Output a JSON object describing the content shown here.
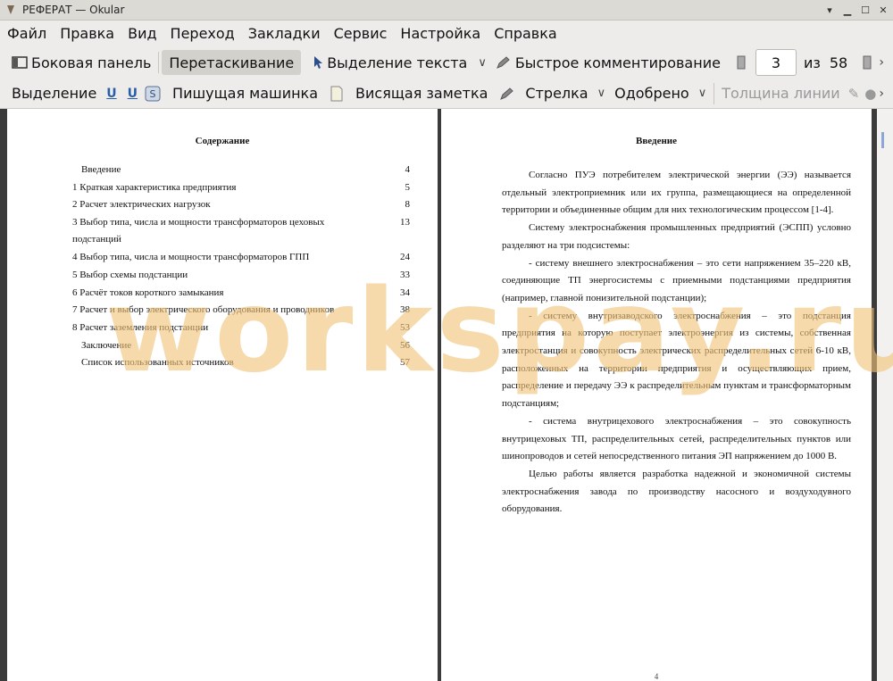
{
  "window": {
    "title": "РЕФЕРАТ  — Okular"
  },
  "menu": [
    "Файл",
    "Правка",
    "Вид",
    "Переход",
    "Закладки",
    "Сервис",
    "Настройка",
    "Справка"
  ],
  "toolbar1": {
    "sidebar": "Боковая панель",
    "drag": "Перетаскивание",
    "text_select": "Выделение текста",
    "quick_comment": "Быстрое комментирование",
    "page_current": "3",
    "of_label": "из",
    "page_total": "58"
  },
  "toolbar2": {
    "highlight": "Выделение",
    "typewriter": "Пишущая машинка",
    "sticky_note": "Висящая заметка",
    "arrow": "Стрелка",
    "approved": "Одобрено",
    "line_width": "Толщина линии"
  },
  "left_page": {
    "title": "Содержание",
    "toc": [
      {
        "label": "Введение",
        "page": "4",
        "indent": true
      },
      {
        "label": "1 Краткая характеристика предприятия",
        "page": "5",
        "indent": false
      },
      {
        "label": "2 Расчет электрических нагрузок",
        "page": "8",
        "indent": false
      },
      {
        "label": "3 Выбор типа, числа и мощности трансформаторов цеховых подстанций",
        "page": "13",
        "indent": false
      },
      {
        "label": "4 Выбор типа, числа и мощности трансформаторов ГПП",
        "page": "24",
        "indent": false
      },
      {
        "label": "5 Выбор схемы подстанции",
        "page": "33",
        "indent": false
      },
      {
        "label": "6 Расчёт токов короткого замыкания",
        "page": "34",
        "indent": false
      },
      {
        "label": "7 Расчет и выбор электрического оборудования и проводников",
        "page": "38",
        "indent": false
      },
      {
        "label": "8 Расчет заземления подстанции",
        "page": "53",
        "indent": false
      },
      {
        "label": "Заключение",
        "page": "56",
        "indent": true
      },
      {
        "label": "Список использованных источников",
        "page": "57",
        "indent": true
      }
    ]
  },
  "right_page": {
    "title": "Введение",
    "paragraphs": [
      "Согласно ПУЭ потребителем электрической энергии (ЭЭ) называется отдельный электроприемник или их группа, размещающиеся на определенной территории и объединенные общим для них технологическим процессом [1-4].",
      "Систему электроснабжения промышленных предприятий (ЭСПП) условно разделяют на три подсистемы:",
      "- систему внешнего электроснабжения – это сети напряжением 35–220 кВ, соединяющие ТП энергосистемы с приемными подстанциями предприятия (например, главной понизительной подстанции);",
      "- систему внутризаводского электроснабжения – это подстанция предприятия на которую поступает электроэнергия из системы, собственная электростанция и совокупность электрических распределительных сетей 6-10 кВ, расположенных на территории предприятия и осуществляющих прием, распределение и передачу ЭЭ к распределительным пунктам и трансформаторным подстанциям;",
      "- система внутрицехового электроснабжения – это совокупность внутрицеховых ТП, распределительных сетей, распределительных пунктов или шинопроводов и сетей непосредственного питания ЭП напряжением до 1000 В.",
      "Целью работы является разработка надежной и экономичной системы электроснабжения завода по производству насосного и воздуходувного оборудования."
    ],
    "page_number": "4"
  },
  "watermark": "workspay.ru"
}
